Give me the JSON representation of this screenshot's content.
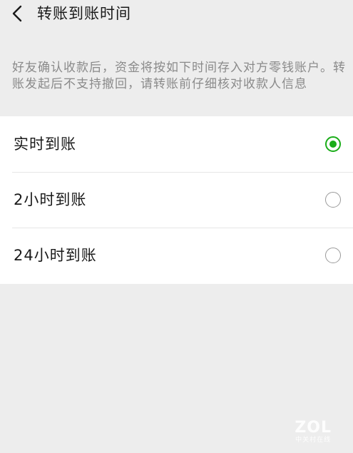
{
  "header": {
    "back_icon": "chevron-left-icon",
    "title": "转账到账时间"
  },
  "description": "好友确认收款后，资金将按如下时间存入对方零钱账户。转账发起后不支持撤回，请转账前仔细核对收款人信息",
  "options": [
    {
      "label": "实时到账",
      "selected": true
    },
    {
      "label": "2小时到账",
      "selected": false
    },
    {
      "label": "24小时到账",
      "selected": false
    }
  ],
  "colors": {
    "accent": "#1aad19",
    "background": "#ededed",
    "card": "#ffffff"
  },
  "watermark": {
    "logo": "ZOL",
    "sub": "中关村在线"
  }
}
